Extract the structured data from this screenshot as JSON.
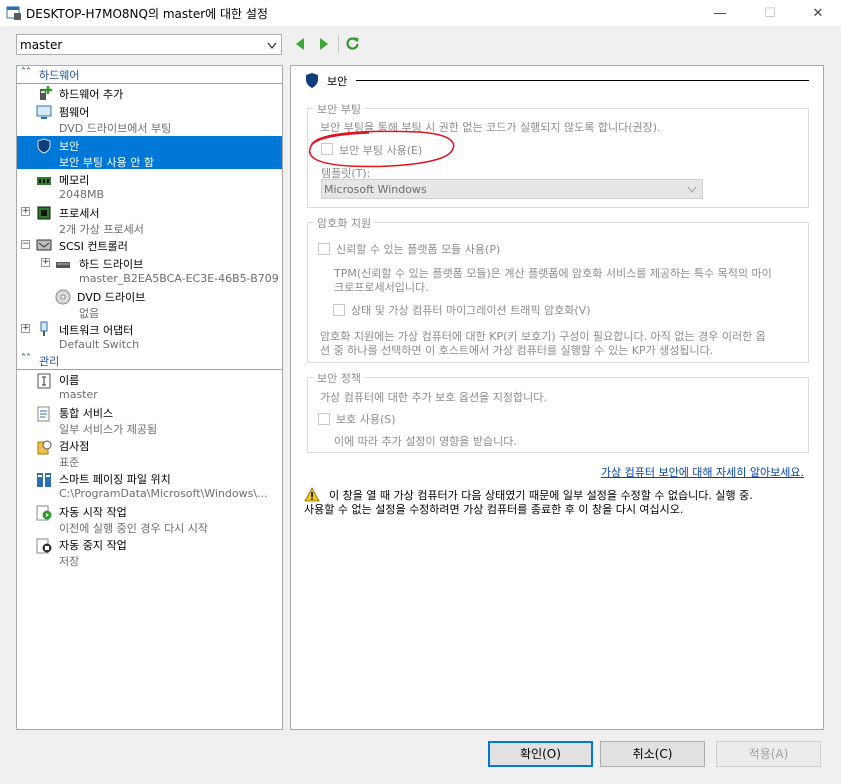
{
  "window": {
    "title": "DESKTOP-H7MO8NQ의 master에 대한 설정",
    "min_glyph": "—",
    "max_glyph": "☐",
    "close_glyph": "✕"
  },
  "toolbar": {
    "vm_select_value": "master",
    "back_icon": "back-arrow-icon",
    "forward_icon": "forward-arrow-icon",
    "refresh_icon": "refresh-icon"
  },
  "sidebar": {
    "hardware_header": "하드웨어",
    "management_header": "관리",
    "add_hardware": "하드웨어 추가",
    "firmware": {
      "title": "펌웨어",
      "sub": "DVD 드라이브에서 부팅"
    },
    "security": {
      "title": "보안",
      "sub": "보안 부팅 사용 안 함"
    },
    "memory": {
      "title": "메모리",
      "sub": "2048MB"
    },
    "processor": {
      "title": "프로세서",
      "sub": "2개 가상 프로세서"
    },
    "scsi": {
      "title": "SCSI 컨트롤러"
    },
    "hdd": {
      "title": "하드 드라이브",
      "sub": "master_B2EA5BCA-EC3E-46B5-B709-F..."
    },
    "dvd": {
      "title": "DVD 드라이브",
      "sub": "없음"
    },
    "network": {
      "title": "네트워크 어댑터",
      "sub": "Default Switch"
    },
    "name": {
      "title": "이름",
      "sub": "master"
    },
    "integration": {
      "title": "통합 서비스",
      "sub": "일부 서비스가 제공됨"
    },
    "checkpoints": {
      "title": "검사점",
      "sub": "표준"
    },
    "paging": {
      "title": "스마트 페이징 파일 위치",
      "sub": "C:\\ProgramData\\Microsoft\\Windows\\..."
    },
    "autostart": {
      "title": "자동 시작 작업",
      "sub": "이전에 실행 중인 경우 다시 시작"
    },
    "autostop": {
      "title": "자동 중지 작업",
      "sub": "저장"
    }
  },
  "security_page": {
    "header": "보안",
    "secure_boot_group": "보안 부팅",
    "secure_boot_desc": "보안 부팅을 통해 부팅 시 권한 없는 코드가 실행되지 않도록 합니다(권장).",
    "secure_boot_checkbox": "보안 부팅 사용(E)",
    "secure_boot_checked": false,
    "template_label": "템플릿(T):",
    "template_value": "Microsoft Windows",
    "encryption_group": "암호화 지원",
    "tpm_checkbox": "신뢰할 수 있는 플랫폼 모듈 사용(P)",
    "tpm_desc_1": "TPM(신뢰할 수 있는 플랫폼 모듈)은 계산 플랫폼에 암호화 서비스를 제공하는 특수 목적의 마이",
    "tpm_desc_2": "크로프로세서입니다.",
    "migration_checkbox": "상태 및 가상 컴퓨터 마이그레이션 트래픽 암호화(V)",
    "kp_desc_1": "암호화 지원에는 가상 컴퓨터에 대한 KP(키 보호기) 구성이 필요합니다. 아직 없는 경우 이러한 옵",
    "kp_desc_2": "션 중 하나를 선택하면 이 호스트에서 가상 컴퓨터를 실행할 수 있는 KP가 생성됩니다.",
    "policy_group": "보안 정책",
    "policy_desc": "가상 컴퓨터에 대한 추가 보호 옵션을 지정합니다.",
    "shielding_checkbox": "보호 사용(S)",
    "shielding_desc": "이에 따라 추가 설정이 영향을 받습니다.",
    "learn_more_link": "가상 컴퓨터 보안에 대해 자세히 알아보세요.",
    "warning_1": "이 창을 열 때 가상 컴퓨터가 다음 상태였기 때문에 일부 설정을 수정할 수 없습니다. 실행 중.",
    "warning_2": "사용할 수 없는 설정을 수정하려면 가상 컴퓨터를 종료한 후 이 창을 다시 여십시오."
  },
  "buttons": {
    "ok": "확인(O)",
    "cancel": "취소(C)",
    "apply": "적용(A)"
  },
  "colors": {
    "accent": "#0078d7",
    "annotation_circle": "#e0141e",
    "link": "#0645ad"
  }
}
